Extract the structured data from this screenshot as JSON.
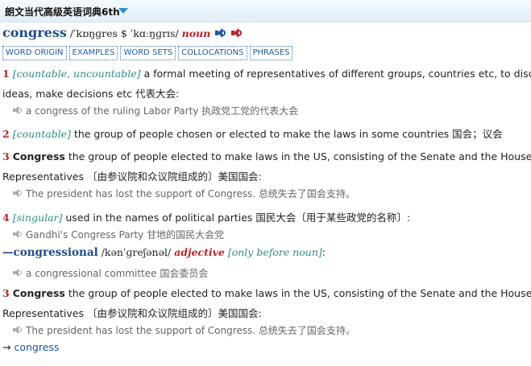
{
  "header": {
    "title": "朗文当代高级英语词典6th"
  },
  "entry": {
    "headword": "congress",
    "pronunciation": "/ˈkɒŋɡres $ ˈkɑːŋɡrɪs/",
    "pos": "noun",
    "tags": [
      "WORD ORIGIN",
      "EXAMPLES",
      "WORD SETS",
      "COLLOCATIONS",
      "PHRASES"
    ]
  },
  "senses": [
    {
      "number": "1",
      "grammar": "[countable, uncountable]",
      "line1": " a formal meeting of representatives of different groups, countries etc, to discuss",
      "line2": "ideas, make decisions etc 代表大会:",
      "example": "a congress of the ruling Labor Party 执政党工党的代表大会"
    },
    {
      "number": "2",
      "grammar": "[countable]",
      "line1": " the group of people chosen or elected to make the laws in some countries 国会；议会"
    },
    {
      "number": "3",
      "word": "Congress",
      "line1": "  the group of people elected to make laws in the US, consisting of the Senate and the House of",
      "line2": "Representatives 〔由参议院和众议院组成的〕美国国会:",
      "example": "The president has lost the support of Congress. 总统失去了国会支持。"
    },
    {
      "number": "4",
      "grammar": "[singular]",
      "line1": " used in the names of political parties 国民大会〔用于某些政党的名称〕:",
      "example": "Gandhi's Congress Party 甘地的国民大会党"
    }
  ],
  "derivative": {
    "dash": "—",
    "word": "congressional",
    "pronunciation": " /kənˈɡreʃənəl/ ",
    "pos": "adjective",
    "grammar": "[only before noun]",
    "colon": ":",
    "example": "a congressional committee 国会委员会"
  },
  "repeat_sense": {
    "number": "3",
    "word": "Congress",
    "line1": "  the group of people elected to make laws in the US, consisting of the Senate and the House of",
    "line2": "Representatives 〔由参议院和众议院组成的〕美国国会:",
    "example": "The president has lost the support of Congress. 总统失去了国会支持。"
  },
  "cross_ref": {
    "arrow": "→ ",
    "word": "congress"
  },
  "colors": {
    "headword": "#1f4e86",
    "number": "#b8232b",
    "grammar": "#2f8a8a",
    "tag": "#1a5aa8"
  },
  "icons": {
    "play_us": "speaker-blue-icon",
    "play_uk": "speaker-red-icon",
    "example_play": "speaker-gray-icon",
    "dropdown": "triangle-down-icon"
  }
}
